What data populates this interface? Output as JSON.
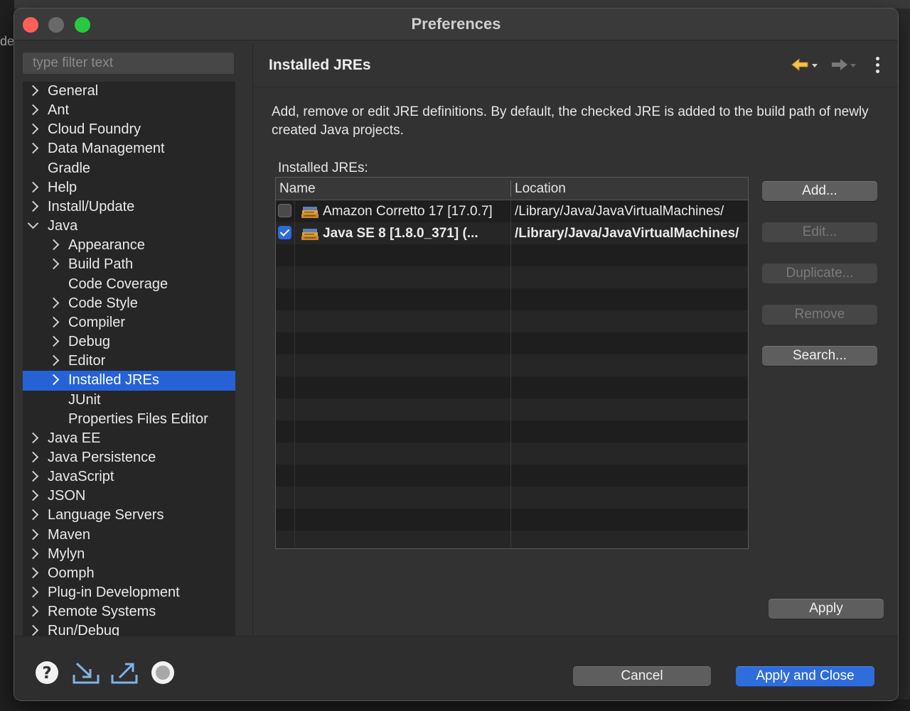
{
  "background": {
    "left_text": "de"
  },
  "window": {
    "title": "Preferences"
  },
  "filter": {
    "placeholder": "type filter text",
    "value": ""
  },
  "tree": {
    "items": [
      {
        "label": "General",
        "level": 0,
        "expander": "collapsed"
      },
      {
        "label": "Ant",
        "level": 0,
        "expander": "collapsed"
      },
      {
        "label": "Cloud Foundry",
        "level": 0,
        "expander": "collapsed"
      },
      {
        "label": "Data Management",
        "level": 0,
        "expander": "collapsed"
      },
      {
        "label": "Gradle",
        "level": 0,
        "expander": "none"
      },
      {
        "label": "Help",
        "level": 0,
        "expander": "collapsed"
      },
      {
        "label": "Install/Update",
        "level": 0,
        "expander": "collapsed"
      },
      {
        "label": "Java",
        "level": 0,
        "expander": "expanded"
      },
      {
        "label": "Appearance",
        "level": 1,
        "expander": "collapsed"
      },
      {
        "label": "Build Path",
        "level": 1,
        "expander": "collapsed"
      },
      {
        "label": "Code Coverage",
        "level": 1,
        "expander": "none"
      },
      {
        "label": "Code Style",
        "level": 1,
        "expander": "collapsed"
      },
      {
        "label": "Compiler",
        "level": 1,
        "expander": "collapsed"
      },
      {
        "label": "Debug",
        "level": 1,
        "expander": "collapsed"
      },
      {
        "label": "Editor",
        "level": 1,
        "expander": "collapsed"
      },
      {
        "label": "Installed JREs",
        "level": 1,
        "expander": "collapsed",
        "selected": true
      },
      {
        "label": "JUnit",
        "level": 1,
        "expander": "none"
      },
      {
        "label": "Properties Files Editor",
        "level": 1,
        "expander": "none"
      },
      {
        "label": "Java EE",
        "level": 0,
        "expander": "collapsed"
      },
      {
        "label": "Java Persistence",
        "level": 0,
        "expander": "collapsed"
      },
      {
        "label": "JavaScript",
        "level": 0,
        "expander": "collapsed"
      },
      {
        "label": "JSON",
        "level": 0,
        "expander": "collapsed"
      },
      {
        "label": "Language Servers",
        "level": 0,
        "expander": "collapsed"
      },
      {
        "label": "Maven",
        "level": 0,
        "expander": "collapsed"
      },
      {
        "label": "Mylyn",
        "level": 0,
        "expander": "collapsed"
      },
      {
        "label": "Oomph",
        "level": 0,
        "expander": "collapsed"
      },
      {
        "label": "Plug-in Development",
        "level": 0,
        "expander": "collapsed"
      },
      {
        "label": "Remote Systems",
        "level": 0,
        "expander": "collapsed"
      },
      {
        "label": "Run/Debug",
        "level": 0,
        "expander": "collapsed"
      }
    ]
  },
  "page": {
    "title": "Installed JREs",
    "description": "Add, remove or edit JRE definitions. By default, the checked JRE is added to the build path of newly created Java projects.",
    "table_label": "Installed JREs:",
    "columns": {
      "name": "Name",
      "location": "Location"
    },
    "rows": [
      {
        "checked": false,
        "name": "Amazon Corretto 17 [17.0.7]",
        "location": "/Library/Java/JavaVirtualMachines/",
        "bold": false
      },
      {
        "checked": true,
        "name": "Java SE 8 [1.8.0_371] (...",
        "location": "/Library/Java/JavaVirtualMachines/",
        "bold": true
      }
    ],
    "empty_rows": 14,
    "buttons": {
      "add": "Add...",
      "edit": "Edit...",
      "duplicate": "Duplicate...",
      "remove": "Remove",
      "search": "Search...",
      "apply": "Apply"
    }
  },
  "footer": {
    "cancel": "Cancel",
    "apply_close": "Apply and Close",
    "icons": [
      "help-icon",
      "import-icon",
      "export-icon",
      "record-icon"
    ]
  },
  "colors": {
    "selection": "#2662d6",
    "primary_button": "#2e6ddb",
    "arrow_back": "#f2c14e",
    "close": "#ff5f57",
    "maximize": "#2ac840"
  }
}
